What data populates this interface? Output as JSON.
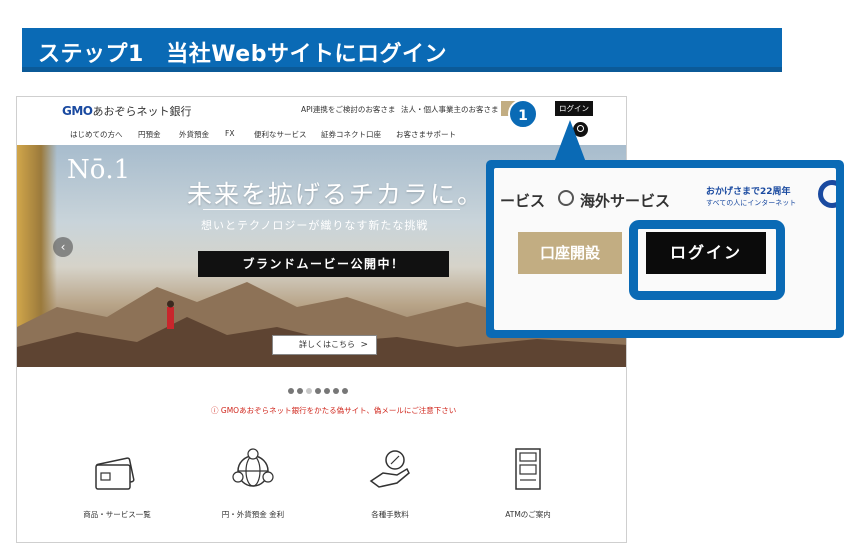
{
  "step_header": {
    "title": "ステップ1　当社Webサイトにログイン"
  },
  "site": {
    "logo": {
      "mark": "GMO",
      "name": "あおぞらネット銀行"
    },
    "top_links": [
      "API連携をご検討のお客さま",
      "法人・個人事業主のお客さま"
    ],
    "login_label": "ログイン",
    "step_badge": "1",
    "nav": [
      "はじめての方へ",
      "円預金",
      "外貨預金",
      "FX",
      "便利なサービス",
      "証券コネクト口座",
      "お客さまサポート"
    ],
    "hero": {
      "no1": "Nō.1",
      "title": "未来を拡げるチカラに。",
      "subtitle": "想いとテクノロジーが織りなす新たな挑戦",
      "movie_label": "ブランドムービー公開中！",
      "detail_label": "詳しくはこちら",
      "detail_arrow": ">"
    },
    "carousel": {
      "count": 7,
      "active_index": 2
    },
    "notice": "ⓘ GMOあおぞらネット銀行をかたる偽サイト、偽メールにご注意下さい",
    "services": [
      {
        "icon": "card-icon",
        "label": "商品・サービス一覧"
      },
      {
        "icon": "globe-currency-icon",
        "label": "円・外貨預金 金利"
      },
      {
        "icon": "percent-hand-icon",
        "label": "各種手数料"
      },
      {
        "icon": "atm-icon",
        "label": "ATMのご案内"
      }
    ]
  },
  "zoom": {
    "nav1": "ービス",
    "nav2": "海外サービス",
    "promo1": "おかげさまで22周年",
    "promo2": "すべての人にインターネット",
    "open_account": "口座開設",
    "login": "ログイン"
  },
  "colors": {
    "accent": "#0a6ab5",
    "gold": "#c2ad82",
    "alert": "#d0271d"
  }
}
